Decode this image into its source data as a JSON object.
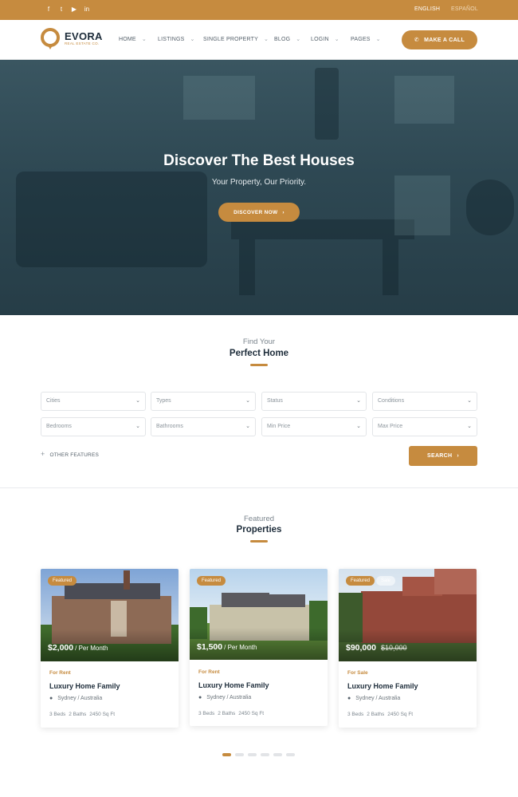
{
  "topbar": {
    "social_icons": [
      "facebook-icon",
      "twitter-icon",
      "youtube-icon",
      "linkedin-icon"
    ],
    "social_glyphs": [
      "f",
      "t",
      "▶",
      "in"
    ],
    "languages": [
      "ENGLISH",
      "ESPAÑOL"
    ]
  },
  "header": {
    "brand": "EVORA",
    "brand_sub": "REAL ESTATE CO.",
    "nav": [
      "HOME",
      "LISTINGS",
      "SINGLE PROPERTY",
      "BLOG",
      "LOGIN",
      "PAGES"
    ],
    "call_button": "MAKE A CALL",
    "call_icon": "phone-icon"
  },
  "hero": {
    "title": "Discover The Best Houses",
    "subtitle": "Your Property, Our Priority.",
    "button": "DISCOVER NOW",
    "button_icon": "chevron-right-icon"
  },
  "search": {
    "subheading": "Find Your",
    "heading": "Perfect Home",
    "fields_row1": [
      "Cities",
      "Types",
      "Status",
      "Conditions"
    ],
    "fields_row2": [
      "Bedrooms",
      "Bathrooms",
      "Min Price",
      "Max Price"
    ],
    "other_features": "OTHER FEATURES",
    "button": "SEARCH"
  },
  "featured": {
    "subheading": "Featured",
    "heading": "Properties",
    "cards": [
      {
        "badge": "Featured",
        "price": "$2,000",
        "price_suffix": "/ Per Month",
        "status": "For Rent",
        "title": "Luxury Home Family",
        "location": "Sydney / Australia",
        "beds": "3 Beds",
        "baths": "2 Baths",
        "area": "2450 Sq Ft"
      },
      {
        "badge": "Featured",
        "price": "$1,500",
        "price_suffix": "/ Per Month",
        "status": "For Rent",
        "title": "Luxury Home Family",
        "location": "Sydney / Australia",
        "beds": "3 Beds",
        "baths": "2 Baths",
        "area": "2450 Sq Ft"
      },
      {
        "badge": "Featured",
        "badge2": "Sale",
        "price": "$90,000",
        "price_old": "$10,000",
        "status": "For Sale",
        "title": "Luxury Home Family",
        "location": "Sydney / Australia",
        "beds": "3 Beds",
        "baths": "2 Baths",
        "area": "2450 Sq Ft"
      }
    ],
    "carousel_pages": 6,
    "carousel_active": 1
  },
  "colors": {
    "accent": "#c68b3f",
    "dark": "#1d2c3a",
    "hero_overlay": "#2c4550"
  }
}
